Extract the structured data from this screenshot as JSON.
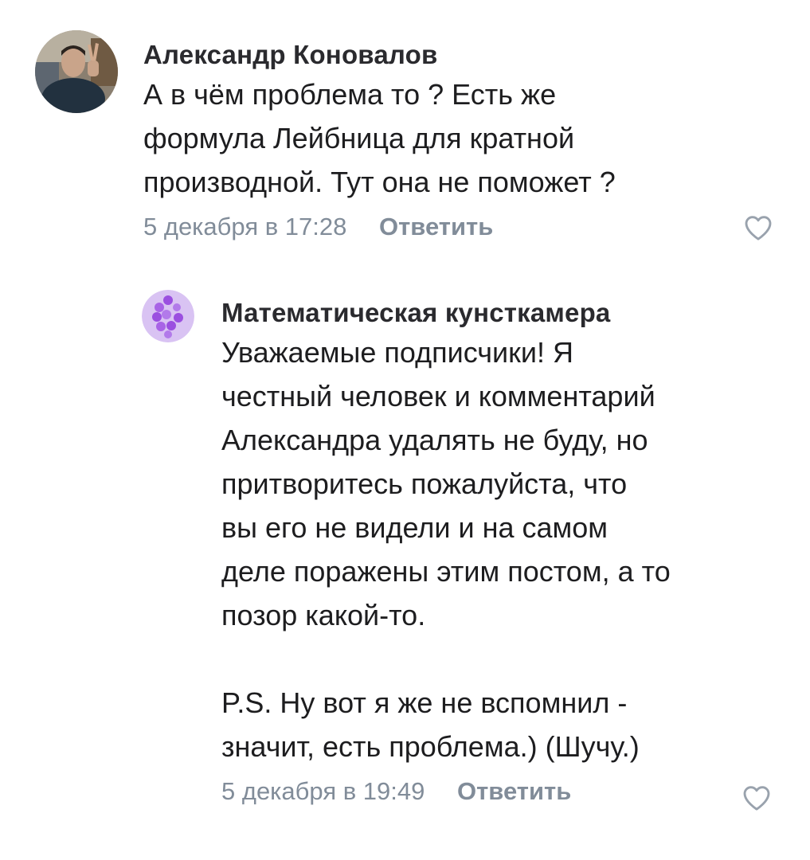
{
  "comments": [
    {
      "author": "Александр Коновалов",
      "text": "А в чём проблема то ? Есть же\nформула Лейбница для кратной\nпроизводной. Тут она не поможет ?",
      "date": "5 декабря в 17:28",
      "reply_label": "Ответить",
      "like_icon": "heart-outline-icon"
    },
    {
      "author": "Математическая кунсткамера",
      "text": "Уважаемые подписчики! Я\nчестный человек и комментарий\nАлександра удалять не буду, но\nпритворитесь пожалуйста, что\nвы его не видели и на самом\nделе поражены этим постом, а то\nпозор какой-то.\n\nP.S. Ну вот я же не вспомнил -\nзначит, есть проблема.) (Шучу.)",
      "date": "5 декабря в 19:49",
      "reply_label": "Ответить",
      "like_icon": "heart-outline-icon"
    }
  ],
  "colors": {
    "text": "#1d1d1f",
    "secondary": "#818c99",
    "group_avatar_bg": "#d9c3f3",
    "group_avatar_dots": "#9b4fe0"
  }
}
